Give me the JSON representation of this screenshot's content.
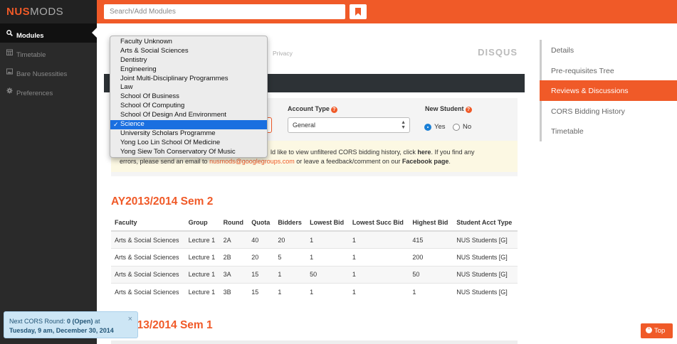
{
  "brand": {
    "left": "NUS",
    "right": "MODS"
  },
  "search": {
    "placeholder": "Search/Add Modules"
  },
  "sidebar": {
    "items": [
      {
        "label": "Modules",
        "icon": "search-icon"
      },
      {
        "label": "Timetable",
        "icon": "calendar-icon"
      },
      {
        "label": "Bare Nusessities",
        "icon": "image-icon"
      },
      {
        "label": "Preferences",
        "icon": "gear-icon"
      }
    ]
  },
  "disqus": {
    "privacy": "Privacy",
    "logo": "DISQUS"
  },
  "filters": {
    "faculty_label": "",
    "account_label": "Account Type",
    "account_value": "General",
    "new_student_label": "New Student",
    "yes": "Yes",
    "no": "No",
    "new_student_selected": "Yes"
  },
  "notice": {
    "part1": "ld like to view unfiltered CORS bidding history, click ",
    "here": "here",
    "part2": ". If you find any",
    "part3": "errors, please send an email to ",
    "email": "nusmods@googlegroups.com",
    "part4": " or leave a feedback/comment on our ",
    "fb": "Facebook page",
    "part5": "."
  },
  "sem1": {
    "title": "AY2013/2014 Sem 2"
  },
  "sem2": {
    "title": "013/2014 Sem 1"
  },
  "table": {
    "headers": [
      "Faculty",
      "Group",
      "Round",
      "Quota",
      "Bidders",
      "Lowest Bid",
      "Lowest Succ Bid",
      "Highest Bid",
      "Student Acct Type"
    ],
    "rows": [
      [
        "Arts & Social Sciences",
        "Lecture 1",
        "2A",
        "40",
        "20",
        "1",
        "1",
        "415",
        "NUS Students [G]"
      ],
      [
        "Arts & Social Sciences",
        "Lecture 1",
        "2B",
        "20",
        "5",
        "1",
        "1",
        "200",
        "NUS Students [G]"
      ],
      [
        "Arts & Social Sciences",
        "Lecture 1",
        "3A",
        "15",
        "1",
        "50",
        "1",
        "50",
        "NUS Students [G]"
      ],
      [
        "Arts & Social Sciences",
        "Lecture 1",
        "3B",
        "15",
        "1",
        "1",
        "1",
        "1",
        "NUS Students [G]"
      ]
    ]
  },
  "rightnav": {
    "items": [
      "Details",
      "Pre-requisites Tree",
      "Reviews & Discussions",
      "CORS Bidding History",
      "Timetable"
    ],
    "active": "Reviews & Discussions"
  },
  "dropdown": {
    "options": [
      "Faculty Unknown",
      "Arts & Social Sciences",
      "Dentistry",
      "Engineering",
      "Joint Multi-Disciplinary Programmes",
      "Law",
      "School Of Business",
      "School Of Computing",
      "School Of Design And Environment",
      "Science",
      "University Scholars Programme",
      "Yong Loo Lin School Of Medicine",
      "Yong Siew Toh Conservatory Of Music"
    ],
    "selected": "Science"
  },
  "toast": {
    "line1_prefix": "Next CORS Round: ",
    "line1_bold": "0 (Open)",
    "line1_suffix": " at",
    "line2": "Tuesday, 9 am, December 30, 2014",
    "close": "×"
  },
  "top_button": {
    "label": "Top"
  },
  "colors": {
    "accent": "#f05a28",
    "sidebar": "#2a2a2a",
    "select_blue": "#1a6fe0"
  }
}
